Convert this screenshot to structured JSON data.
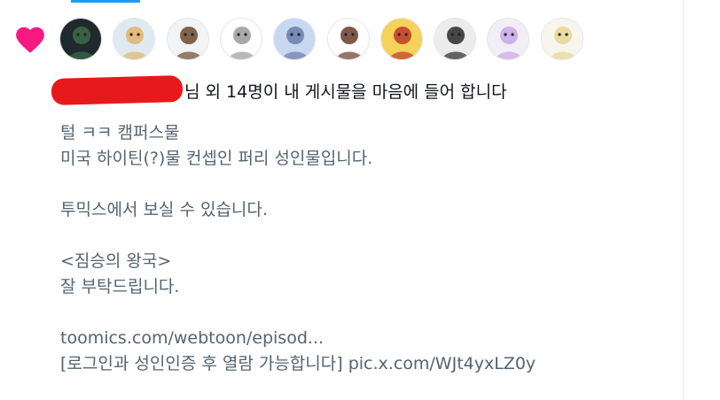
{
  "notification": {
    "icon": "heart-icon",
    "heart_color": "#f91880",
    "summary_suffix": "님 외 14명이 내 게시물을 마음에 들어 합니다",
    "avatars": [
      {
        "label": "dark-creature-avatar",
        "bg": "#1f2a2c",
        "fg": "#3e6b4a"
      },
      {
        "label": "cat-girl-avatar",
        "bg": "#dfe9f0",
        "fg": "#e3b46a"
      },
      {
        "label": "dog-suit-avatar",
        "bg": "#f1f3f5",
        "fg": "#6b4a2e"
      },
      {
        "label": "doodle-bird-avatar",
        "bg": "#ffffff",
        "fg": "#9a9a9a"
      },
      {
        "label": "wolf-mascot-avatar",
        "bg": "#c9d8f2",
        "fg": "#6a7ea8"
      },
      {
        "label": "boxhead-figure-avatar",
        "bg": "#ffffff",
        "fg": "#6b3a2a"
      },
      {
        "label": "fiery-character-avatar",
        "bg": "#f5d25a",
        "fg": "#c0392b"
      },
      {
        "label": "dark-hair-girl-avatar",
        "bg": "#ececec",
        "fg": "#2a2a2a"
      },
      {
        "label": "white-hair-girl-avatar",
        "bg": "#f1eef6",
        "fg": "#c9a7e6"
      },
      {
        "label": "blonde-sketch-avatar",
        "bg": "#f7f5ee",
        "fg": "#e8d690"
      }
    ]
  },
  "tweet": {
    "lines": [
      "털 ㅋㅋ 캠퍼스물",
      "미국 하이틴(?)물 컨셉인 퍼리 성인물입니다.",
      "",
      "투믹스에서 보실 수 있습니다.",
      "",
      "<짐승의 왕국>",
      "잘 부탁드립니다.",
      ""
    ],
    "link_line": "toomics.com/webtoon/episod...",
    "last_line_text": "[로그인과 성인인증 후 열람 가능합니다] ",
    "last_line_link": "pic.x.com/WJt4yxLZ0y"
  },
  "colors": {
    "accent": "#1d9bf0",
    "redaction": "#e8191d",
    "text_primary": "#0f1419",
    "text_secondary": "#536471"
  }
}
